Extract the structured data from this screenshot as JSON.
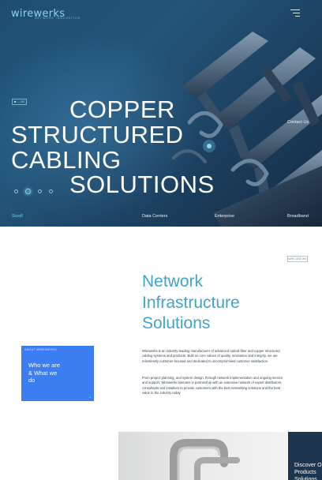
{
  "header": {
    "logo": "wirewerks",
    "logo_tagline": "NETWORK INNOVATION",
    "menu_icon": "hamburger-menu-icon"
  },
  "hero": {
    "slide_counter": "■ — 02",
    "headline": [
      "COPPER",
      "STRUCTURED",
      "CABLING",
      "SOLUTIONS"
    ],
    "contact_link": "Contact Us",
    "scroll_label": "Scroll",
    "nav": [
      "Data Centers",
      "Enterprise",
      "Broadband"
    ],
    "slider_dots": 4,
    "active_dot": 2
  },
  "about": {
    "tag": "WHO ARE WE",
    "title": [
      "Network",
      "Infrastructure",
      "Solutions"
    ],
    "card_label": "ABOUT WIREWERKS",
    "card_text": "Who we are\n& What we\ndo",
    "card_arrow": "→",
    "paragraph1": "Wirewerks is an industry-leading manufacturer of advanced optical fiber and copper structured cabling systems and products. Built on core values of quality, innovation and integrity, we are relentlessly customer-focused and dedicated to uncompromised customer satisfaction.",
    "paragraph2": "From project planning, and system design, through network implementation and ongoing service and support, Wirewerks operates in partnership with an extensive network of expert distributors, consultants and installers to provide customers with the best networking solutions and the best value in the industry today."
  },
  "products": {
    "panel_text": "Discover O\nProducts\nSolutions"
  },
  "colors": {
    "hero_bg": "#1d4e72",
    "accent_blue": "#3d7df2",
    "title_blue": "#42a3cf",
    "dark_panel": "#1e3550"
  }
}
